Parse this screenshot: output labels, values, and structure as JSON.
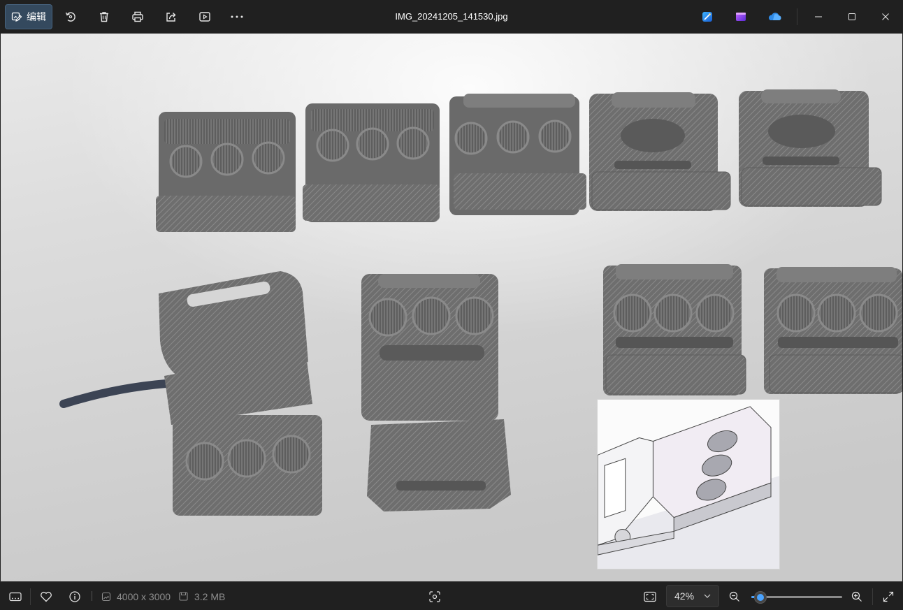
{
  "titlebar": {
    "edit_label": "编辑",
    "filename": "IMG_20241205_141530.jpg"
  },
  "icons": {
    "edit": "edit-image-icon",
    "rotate": "rotate-icon",
    "delete": "trash-icon",
    "print": "print-icon",
    "share": "share-icon",
    "slideshow": "slideshow-icon",
    "more": "more-icon",
    "designer": "designer-app-icon",
    "clipchamp": "clipchamp-app-icon",
    "onedrive": "onedrive-icon"
  },
  "statusbar": {
    "dimensions": "4000 x 3000",
    "file_size": "3.2 MB",
    "zoom_value": "42%",
    "zoom_slider_fraction": 0.1
  },
  "colors": {
    "accent": "#4aa3ff",
    "edit_button": "#34495e",
    "background": "#202020"
  }
}
